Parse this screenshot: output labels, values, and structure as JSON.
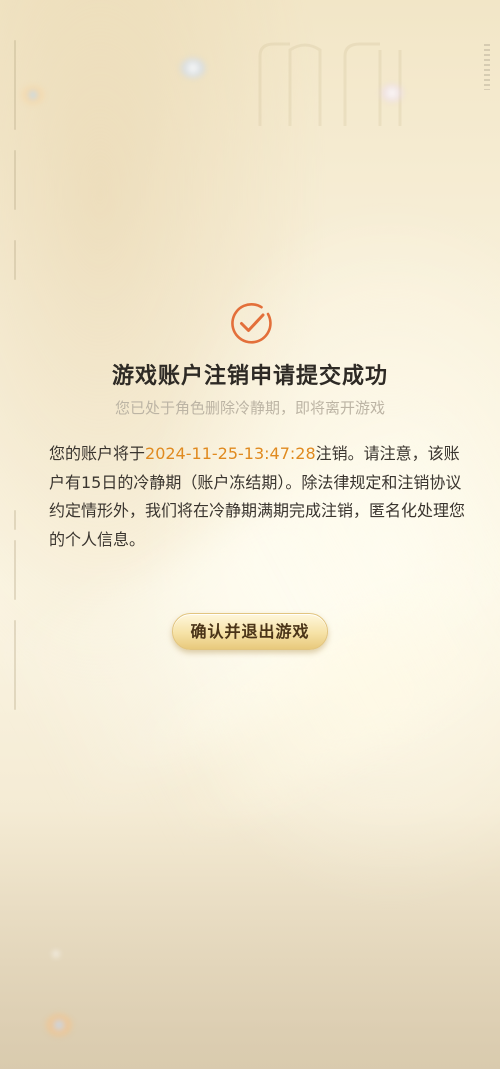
{
  "dialog": {
    "title": "游戏账户注销申请提交成功",
    "subtitle": "您已处于角色删除冷静期，即将离开游戏",
    "description_before": "您的账户将于",
    "deletion_time": "2024-11-25-13:47:28",
    "description_after": "注销。请注意，该账户有15日的冷静期（账户冻结期）。除法律规定和注销协议约定情形外，我们将在冷静期满期完成注销，匿名化处理您的个人信息。",
    "confirm_button": "确认并退出游戏"
  },
  "icons": {
    "status": "check-circle-icon"
  },
  "colors": {
    "accent": "#e36f3a",
    "highlight_time": "#e08a1f",
    "title": "#2e2a25",
    "subtitle": "#bcb4a4",
    "button_gold": "#f6e2a6"
  }
}
